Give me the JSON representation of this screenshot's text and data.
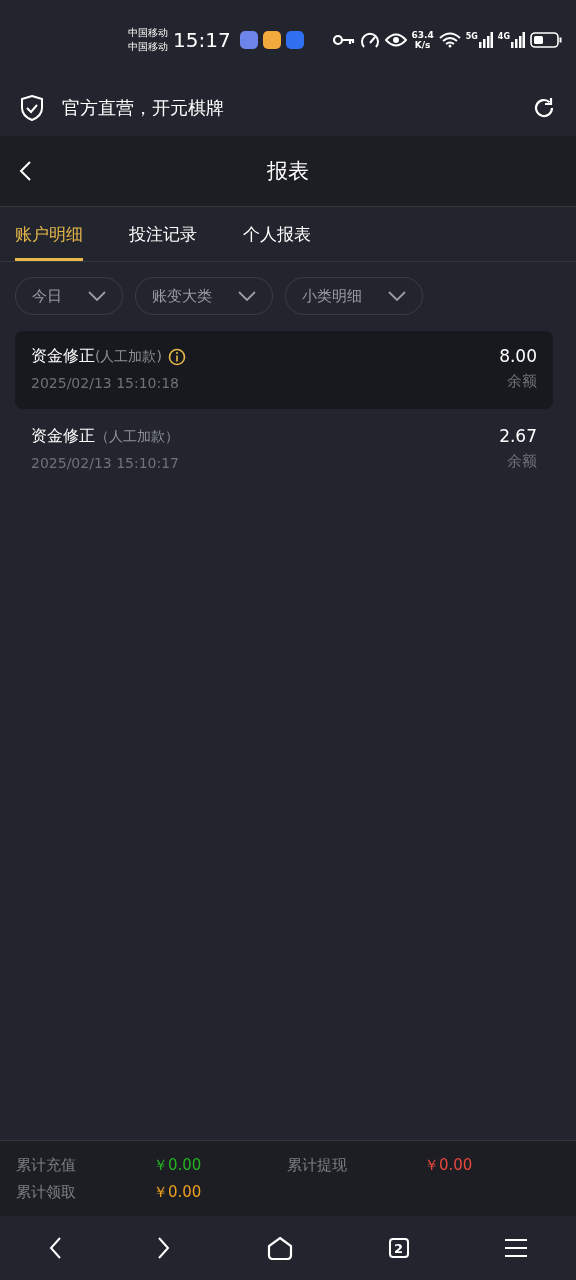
{
  "status_bar": {
    "carriers": [
      "中国移动",
      "中国移动"
    ],
    "time": "15:17",
    "net_speed": "63.4",
    "net_unit": "K/s",
    "signals": [
      {
        "label": "5G"
      },
      {
        "label": "4G"
      }
    ]
  },
  "browser_bar": {
    "title": "官方直营，开元棋牌"
  },
  "header": {
    "title": "报表"
  },
  "tabs": [
    {
      "label": "账户明细",
      "selected": true
    },
    {
      "label": "投注记录",
      "selected": false
    },
    {
      "label": "个人报表",
      "selected": false
    }
  ],
  "filters": [
    {
      "label": "今日"
    },
    {
      "label": "账变大类"
    },
    {
      "label": "小类明细"
    }
  ],
  "records": [
    {
      "title": "资金修正",
      "subtitle": "(人工加款)",
      "info": true,
      "time": "2025/02/13 15:10:18",
      "amount": "8.00",
      "amount_label": "余额",
      "selected": true
    },
    {
      "title": "资金修正",
      "subtitle": "（人工加款）",
      "info": false,
      "time": "2025/02/13 15:10:17",
      "amount": "2.67",
      "amount_label": "余额",
      "selected": false
    }
  ],
  "summary": [
    {
      "label": "累计充值",
      "value": "￥0.00",
      "color": "#22b322"
    },
    {
      "label": "累计提现",
      "value": "￥0.00",
      "color": "#e8483f"
    },
    {
      "label": "累计领取",
      "value": "￥0.00",
      "color": "#f0a020"
    }
  ],
  "nav": {
    "tabs_count": "2"
  }
}
